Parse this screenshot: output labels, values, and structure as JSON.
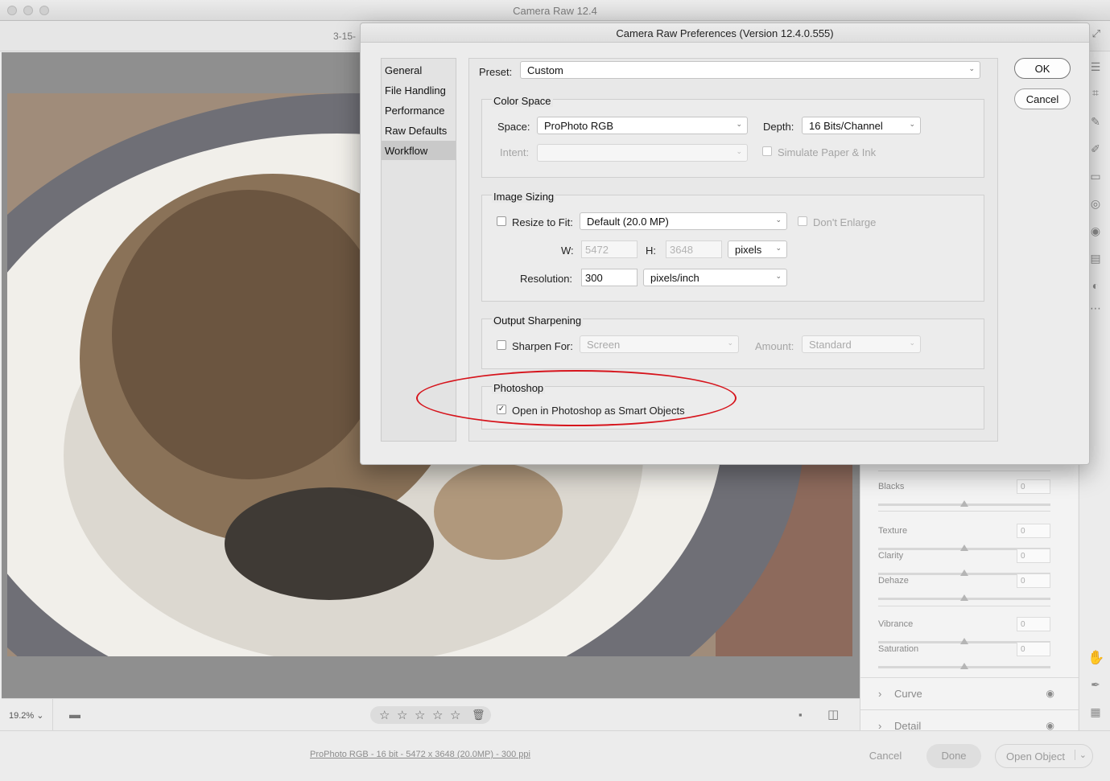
{
  "app": {
    "title": "Camera Raw 12.4",
    "file_label": "3-15-"
  },
  "dialog": {
    "title": "Camera Raw Preferences  (Version 12.4.0.555)",
    "sidebar": [
      "General",
      "File Handling",
      "Performance",
      "Raw Defaults",
      "Workflow"
    ],
    "active_section": "Workflow",
    "preset": {
      "label": "Preset:",
      "value": "Custom"
    },
    "color_space": {
      "title": "Color Space",
      "space_label": "Space:",
      "space_value": "ProPhoto RGB",
      "depth_label": "Depth:",
      "depth_value": "16 Bits/Channel",
      "intent_label": "Intent:",
      "intent_value": "",
      "simulate_label": "Simulate Paper & Ink",
      "simulate_checked": false
    },
    "image_sizing": {
      "title": "Image Sizing",
      "resize_label": "Resize to Fit:",
      "resize_checked": false,
      "resize_value": "Default  (20.0 MP)",
      "dont_enlarge_label": "Don't Enlarge",
      "dont_enlarge_checked": false,
      "w_label": "W:",
      "w_value": "5472",
      "h_label": "H:",
      "h_value": "3648",
      "unit_value": "pixels",
      "resolution_label": "Resolution:",
      "resolution_value": "300",
      "resolution_unit": "pixels/inch"
    },
    "output_sharpening": {
      "title": "Output Sharpening",
      "sharpen_label": "Sharpen For:",
      "sharpen_checked": false,
      "sharpen_value": "Screen",
      "amount_label": "Amount:",
      "amount_value": "Standard"
    },
    "photoshop": {
      "title": "Photoshop",
      "smart_objects_label": "Open in Photoshop as Smart Objects",
      "smart_objects_checked": true
    },
    "ok_label": "OK",
    "cancel_label": "Cancel"
  },
  "right_panel": {
    "sliders": [
      {
        "label": "Blacks",
        "value": "0"
      },
      {
        "label": "Texture",
        "value": "0"
      },
      {
        "label": "Clarity",
        "value": "0"
      },
      {
        "label": "Dehaze",
        "value": "0"
      },
      {
        "label": "Vibrance",
        "value": "0"
      },
      {
        "label": "Saturation",
        "value": "0"
      }
    ],
    "sections": [
      "Curve",
      "Detail"
    ]
  },
  "bottom": {
    "zoom": "19.2%",
    "info": "ProPhoto RGB - 16 bit - 5472 x 3648 (20.0MP) - 300 ppi",
    "cancel_label": "Cancel",
    "done_label": "Done",
    "open_label": "Open Object"
  },
  "colors": {
    "annotation": "#d6141c",
    "active_sidebar": "#c9c9c9"
  }
}
